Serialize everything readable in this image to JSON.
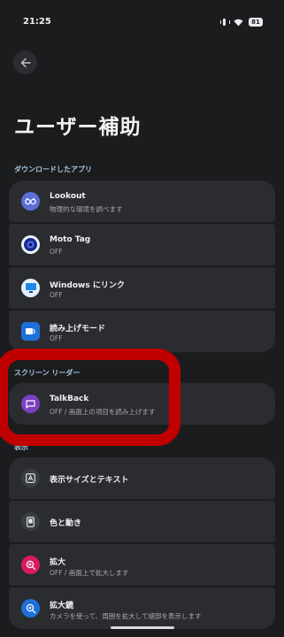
{
  "status": {
    "time": "21:25",
    "battery": "81"
  },
  "title": "ユーザー補助",
  "sections": {
    "downloaded": "ダウンロードしたアプリ",
    "screen_reader": "スクリーン リーダー",
    "display": "表示"
  },
  "downloaded_apps": [
    {
      "title": "Lookout",
      "subtitle": "物理的な環境を調べます",
      "icon": "glasses-icon",
      "color": "#5b6fd6"
    },
    {
      "title": "Moto Tag",
      "subtitle": "OFF",
      "icon": "target-icon",
      "color": "#1a2a8a"
    },
    {
      "title": "Windows にリンク",
      "subtitle": "OFF",
      "icon": "monitor-icon",
      "color": "#1e88e5"
    },
    {
      "title": "読み上げモード",
      "subtitle": "OFF",
      "icon": "reading-icon",
      "color": "#1e6fd9"
    }
  ],
  "screen_reader": {
    "title": "TalkBack",
    "subtitle": "OFF / 画面上の項目を読み上げます",
    "icon": "chat-icon",
    "color": "#7b3fbf"
  },
  "display_items": [
    {
      "title": "表示サイズとテキスト",
      "subtitle": "",
      "icon": "text-size-icon",
      "color": "#3a3d41"
    },
    {
      "title": "色と動き",
      "subtitle": "",
      "icon": "phone-color-icon",
      "color": "#3a3d41"
    },
    {
      "title": "拡大",
      "subtitle": "OFF / 画面上で拡大します",
      "icon": "magnify-icon",
      "color": "#d81b60"
    },
    {
      "title": "拡大鏡",
      "subtitle": "カメラを使って、周囲を拡大して細部を表示します",
      "icon": "magnifier-app-icon",
      "color": "#1e6fd9"
    }
  ]
}
